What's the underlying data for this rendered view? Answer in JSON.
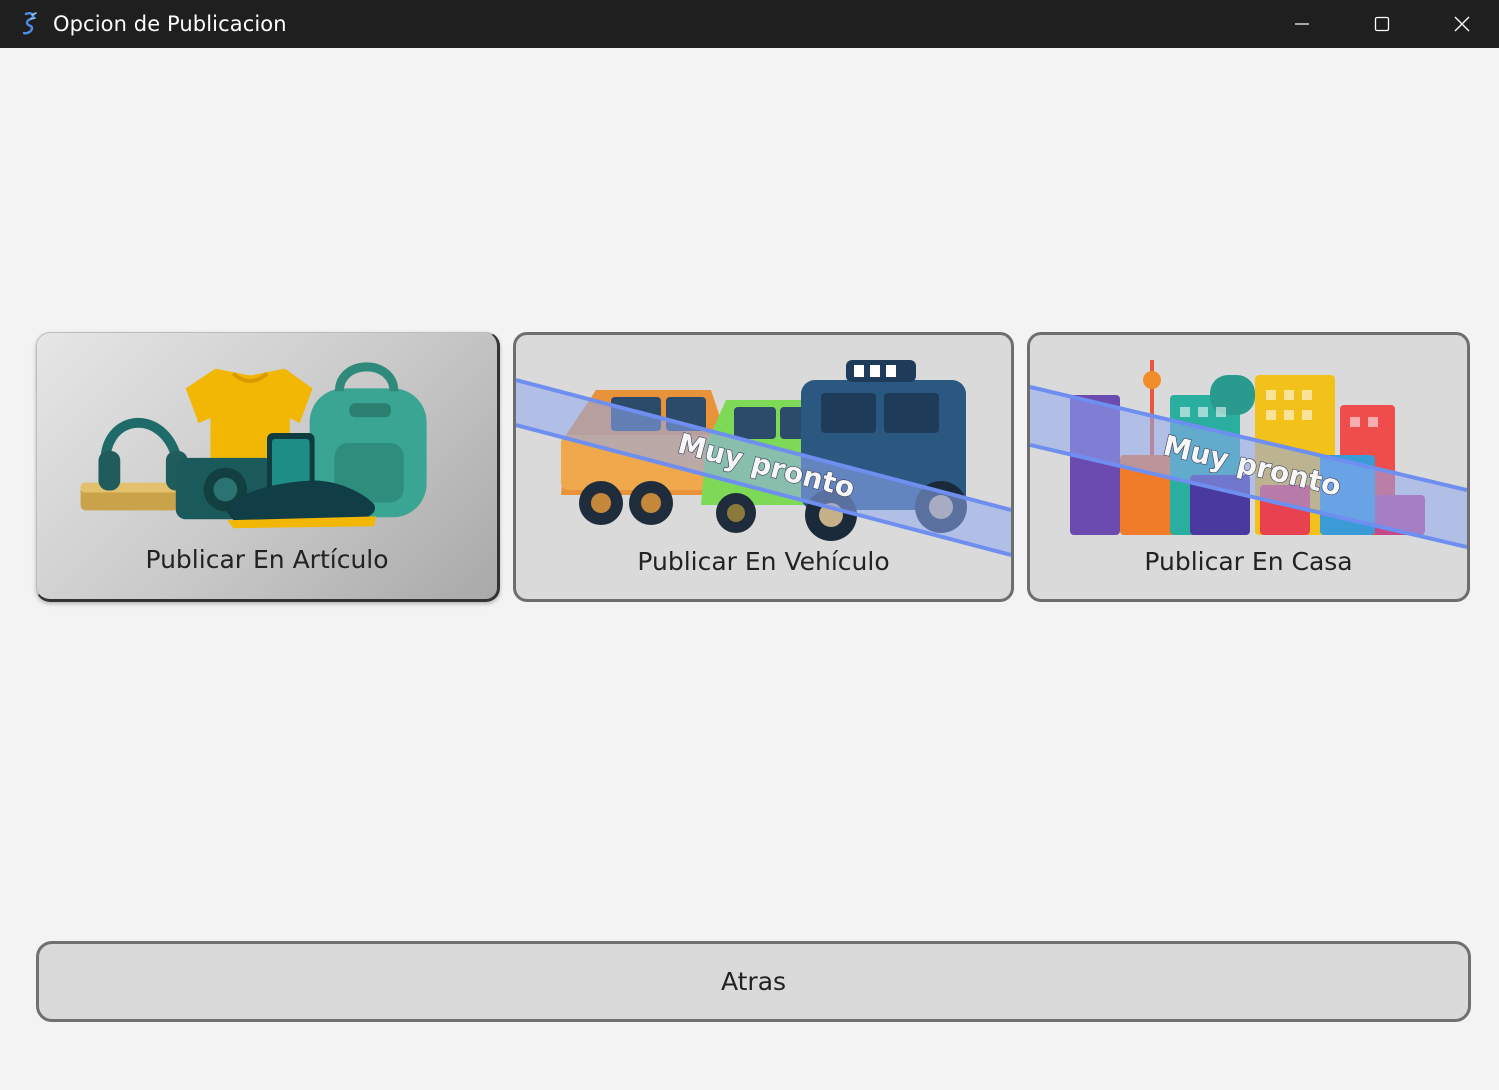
{
  "window": {
    "title": "Opcion de Publicacion",
    "controls": [
      "minimize",
      "maximize",
      "close"
    ]
  },
  "options": [
    {
      "label": "Publicar En Artículo",
      "badge": ""
    },
    {
      "label": "Publicar En Vehículo",
      "badge": "Muy pronto"
    },
    {
      "label": "Publicar En Casa",
      "badge": "Muy pronto"
    }
  ],
  "footer": {
    "back_label": "Atras"
  },
  "colors": {
    "titlebar": "#1f1f1f",
    "background": "#f3f3f3",
    "card": "#dadada",
    "soon_band": "#8fa9f2"
  }
}
